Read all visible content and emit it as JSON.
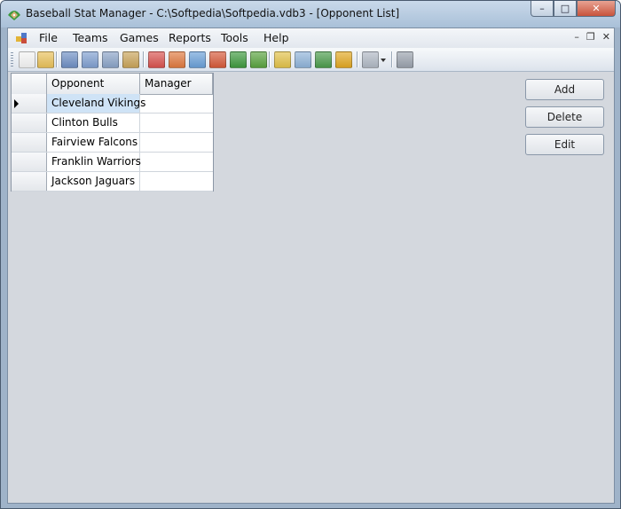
{
  "window": {
    "title": "Baseball Stat Manager - C:\\Softpedia\\Softpedia.vdb3 - [Opponent List]",
    "minimize_glyph": "–",
    "maximize_glyph": "□",
    "close_glyph": "✕"
  },
  "menu": {
    "items": [
      "File",
      "Teams",
      "Games",
      "Reports",
      "Tools",
      "Help"
    ],
    "mdi_minimize": "–",
    "mdi_restore": "❐",
    "mdi_close": "✕"
  },
  "toolbar": {
    "icons": [
      {
        "name": "new-icon",
        "color": "#f4f4f4"
      },
      {
        "name": "open-folder-icon",
        "color": "#e9c15a"
      },
      {
        "name": "player-icon",
        "color": "#6e8fc4"
      },
      {
        "name": "player-edit-icon",
        "color": "#7f9fd0"
      },
      {
        "name": "wrench-icon",
        "color": "#8aa3c7"
      },
      {
        "name": "players-icon",
        "color": "#c9a45a"
      },
      {
        "name": "calendar-icon",
        "color": "#d9534f"
      },
      {
        "name": "calendar-edit-icon",
        "color": "#e07a3f"
      },
      {
        "name": "edit-page-icon",
        "color": "#6aa0d8"
      },
      {
        "name": "calendar-go-icon",
        "color": "#d65a3a"
      },
      {
        "name": "baseball-field-icon",
        "color": "#3f9a3f"
      },
      {
        "name": "puzzle-icon",
        "color": "#5aa33f"
      },
      {
        "name": "report-icon",
        "color": "#e2c24a"
      },
      {
        "name": "table-icon",
        "color": "#8fb3d9"
      },
      {
        "name": "field-report-icon",
        "color": "#4c9c4c"
      },
      {
        "name": "medal-icon",
        "color": "#e2a823"
      },
      {
        "name": "list-dropdown-icon",
        "color": "#b0b8c4"
      },
      {
        "name": "gear-icon",
        "color": "#9aa2ad"
      }
    ]
  },
  "grid": {
    "columns": [
      "Opponent",
      "Manager"
    ],
    "rows": [
      {
        "opponent": "Cleveland Vikings",
        "manager": ""
      },
      {
        "opponent": "Clinton Bulls",
        "manager": ""
      },
      {
        "opponent": "Fairview Falcons",
        "manager": ""
      },
      {
        "opponent": "Franklin Warriors",
        "manager": ""
      },
      {
        "opponent": "Jackson Jaguars",
        "manager": ""
      }
    ],
    "selected_row": 0
  },
  "actions": {
    "add": "Add",
    "delete": "Delete",
    "edit": "Edit"
  }
}
